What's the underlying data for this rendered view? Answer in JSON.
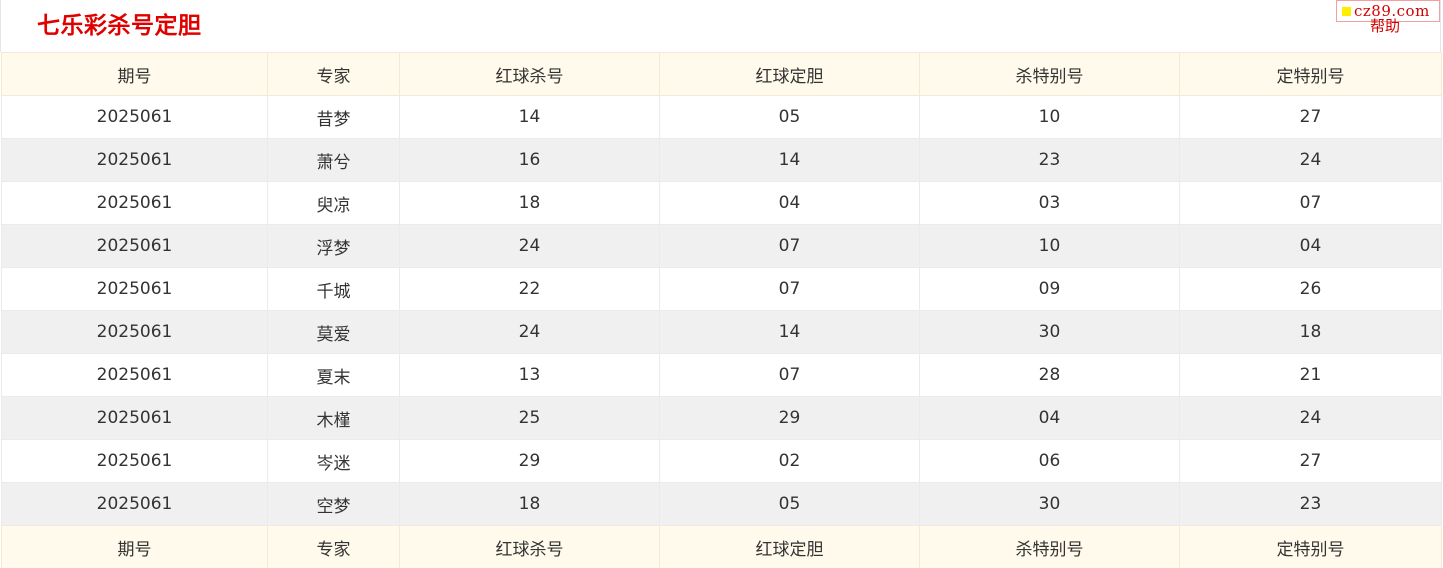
{
  "header": {
    "title": "七乐彩杀号定胆",
    "help_label": "帮助",
    "badge_text": "cz89.com"
  },
  "colors": {
    "title": "#e00000",
    "header_row_bg": "#fffaeb",
    "stripe_bg": "#f0f0f0",
    "badge_square": "#ffee00",
    "badge_text": "#d40000"
  },
  "table": {
    "columns": [
      "期号",
      "专家",
      "红球杀号",
      "红球定胆",
      "杀特别号",
      "定特别号"
    ],
    "rows": [
      [
        "2025061",
        "昔梦",
        "14",
        "05",
        "10",
        "27"
      ],
      [
        "2025061",
        "萧兮",
        "16",
        "14",
        "23",
        "24"
      ],
      [
        "2025061",
        "臾凉",
        "18",
        "04",
        "03",
        "07"
      ],
      [
        "2025061",
        "浮梦",
        "24",
        "07",
        "10",
        "04"
      ],
      [
        "2025061",
        "千城",
        "22",
        "07",
        "09",
        "26"
      ],
      [
        "2025061",
        "莫爱",
        "24",
        "14",
        "30",
        "18"
      ],
      [
        "2025061",
        "夏末",
        "13",
        "07",
        "28",
        "21"
      ],
      [
        "2025061",
        "木槿",
        "25",
        "29",
        "04",
        "24"
      ],
      [
        "2025061",
        "岑迷",
        "29",
        "02",
        "06",
        "27"
      ],
      [
        "2025061",
        "空梦",
        "18",
        "05",
        "30",
        "23"
      ]
    ]
  }
}
